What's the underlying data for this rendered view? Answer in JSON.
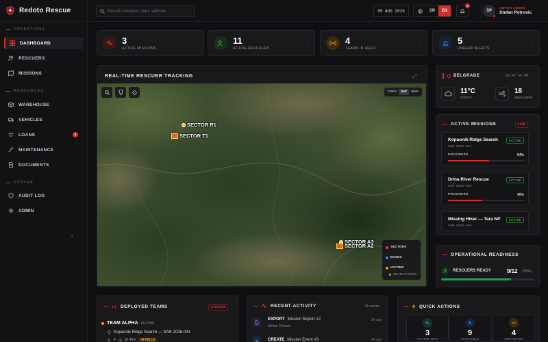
{
  "brand": {
    "name": "Redoto Rescue"
  },
  "sidebar": {
    "sections": [
      {
        "label": "OPERATIONS"
      },
      {
        "label": "RESOURCES"
      },
      {
        "label": "SYSTEM"
      }
    ],
    "items": [
      {
        "label": "DASHBOARD",
        "icon": "grid-icon"
      },
      {
        "label": "RESCUERS",
        "icon": "users-icon"
      },
      {
        "label": "MISSIONS",
        "icon": "map-icon"
      },
      {
        "label": "WAREHOUSE",
        "icon": "box-icon"
      },
      {
        "label": "VEHICLES",
        "icon": "truck-icon"
      },
      {
        "label": "LOANS",
        "icon": "handshake-icon",
        "badge": "1"
      },
      {
        "label": "MAINTENANCE",
        "icon": "wrench-icon"
      },
      {
        "label": "DOCUMENTS",
        "icon": "document-icon"
      },
      {
        "label": "AUDIT LOG",
        "icon": "shield-icon"
      },
      {
        "label": "ADMIN",
        "icon": "gear-icon"
      }
    ]
  },
  "topbar": {
    "search_placeholder": "Search mission, user, vehicle...",
    "date": "05 AUG 2026",
    "lang_sr": "SR",
    "lang_en": "EN",
    "notifications": "5",
    "user_initials": "SP",
    "user_role": "SUPER ADMIN",
    "user_name": "Stefan Petrovic"
  },
  "stats": [
    {
      "value": "3",
      "label": "ACTIVE MISSIONS",
      "color": "#e53935"
    },
    {
      "value": "11",
      "label": "ACTIVE RESCUERS",
      "color": "#43a047"
    },
    {
      "value": "4",
      "label": "TEAMS IN FIELD",
      "color": "#f59e0b"
    },
    {
      "value": "5",
      "label": "UNREAD ALERTS",
      "color": "#3b82f6"
    }
  ],
  "tracking": {
    "title": "REAL-TIME RESCUER TRACKING",
    "modes": [
      "TOPO",
      "SAT",
      "MAP"
    ],
    "active_mode": "SAT",
    "sectors": [
      "SECTOR R1",
      "SECTOR T1",
      "SECTOR A3",
      "SECTOR A2"
    ],
    "legend": [
      {
        "label": "SECTORS",
        "color": "#e53935"
      },
      {
        "label": "BASES",
        "color": "#3b82f6"
      },
      {
        "label": "VICTIMS",
        "color": "#f59e0b"
      }
    ],
    "legend_sub": "SEARCH RADII"
  },
  "weather": {
    "city": "BELGRADE",
    "time": "02:47:54 PM",
    "temp": "11°C",
    "condition": "FOGGY",
    "wind": "18",
    "wind_unit": "KM/H WIND"
  },
  "active_missions": {
    "title": "ACTIVE MISSIONS",
    "badge": "LIVE",
    "progress_label": "PROGRESS",
    "items": [
      {
        "name": "Kopaonik Ridge Search",
        "code": "SAR-2026-041",
        "status": "ACTIVE",
        "progress": 54,
        "progress_text": "54%"
      },
      {
        "name": "Drina River Rescue",
        "code": "SAR-2026-040",
        "status": "ACTIVE",
        "progress": 45,
        "progress_text": "45%"
      },
      {
        "name": "Missing Hiker — Tara NP",
        "code": "SAR-2026-039",
        "status": "ACTIVE"
      }
    ]
  },
  "readiness": {
    "title": "OPERATIONAL READINESS",
    "label": "RESCUERS READY",
    "value": "9/12",
    "percent_text": "(75%)",
    "percent": 75
  },
  "deployed": {
    "title": "DEPLOYED TEAMS",
    "badge": "4 ACTIVE",
    "team": "TEAM ALPHA",
    "team_tag": "(ALPHA)",
    "mission": "Kopaonik Ridge Search — SAR-2026-041",
    "members": "4",
    "duration": "3h 49m",
    "status": "IN FIELD"
  },
  "activity": {
    "title": "RECENT ACTIVITY",
    "count": "14 events",
    "items": [
      {
        "action": "EXPORT",
        "detail": "Mission Report #2",
        "user": "Stefan Petrovic",
        "time": "3h ago"
      },
      {
        "action": "CREATE",
        "detail": "Mission Event #3",
        "time": "4h ago"
      }
    ]
  },
  "quick_actions": {
    "title": "QUICK ACTIONS",
    "items": [
      {
        "value": "3",
        "label": "ACTIVE OPS",
        "color": "#26a69a"
      },
      {
        "value": "9",
        "label": "AVAILABLE",
        "color": "#3b82f6"
      },
      {
        "value": "4",
        "label": "DEPLOYED",
        "color": "#f59e0b"
      }
    ]
  }
}
